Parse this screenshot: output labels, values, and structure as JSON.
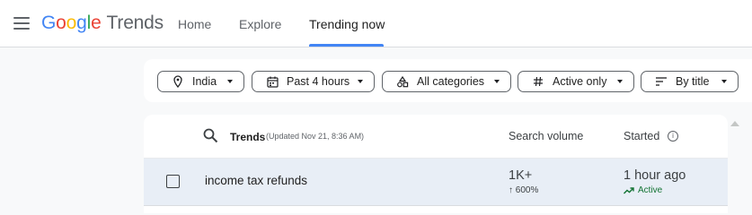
{
  "app": {
    "logo_letters": [
      {
        "char": "G",
        "color": "#4285F4"
      },
      {
        "char": "o",
        "color": "#EA4335"
      },
      {
        "char": "o",
        "color": "#FBBC05"
      },
      {
        "char": "g",
        "color": "#4285F4"
      },
      {
        "char": "l",
        "color": "#34A853"
      },
      {
        "char": "e",
        "color": "#EA4335"
      }
    ],
    "product": "Trends"
  },
  "nav": {
    "home": "Home",
    "explore": "Explore",
    "trending_now": "Trending now",
    "active_tab": "Trending now"
  },
  "filters": {
    "location": {
      "label": "India",
      "icon": "location-pin-icon"
    },
    "time": {
      "label": "Past 4 hours",
      "icon": "calendar-icon"
    },
    "category": {
      "label": "All categories",
      "icon": "categories-icon"
    },
    "status": {
      "label": "Active only",
      "icon": "hash-icon"
    },
    "sort": {
      "label": "By title",
      "icon": "sort-icon"
    }
  },
  "table": {
    "title": "Trends",
    "updated": "(Updated Nov 21, 8:36 AM)",
    "columns": {
      "search_volume": "Search volume",
      "started": "Started"
    },
    "rows": [
      {
        "name": "income tax refunds",
        "volume": "1K+",
        "volume_change": "600%",
        "started": "1 hour ago",
        "status": "Active",
        "selected": false
      }
    ]
  },
  "colors": {
    "accent": "#4285f4",
    "active_status": "#137333",
    "row_highlight": "#e8eef6"
  }
}
